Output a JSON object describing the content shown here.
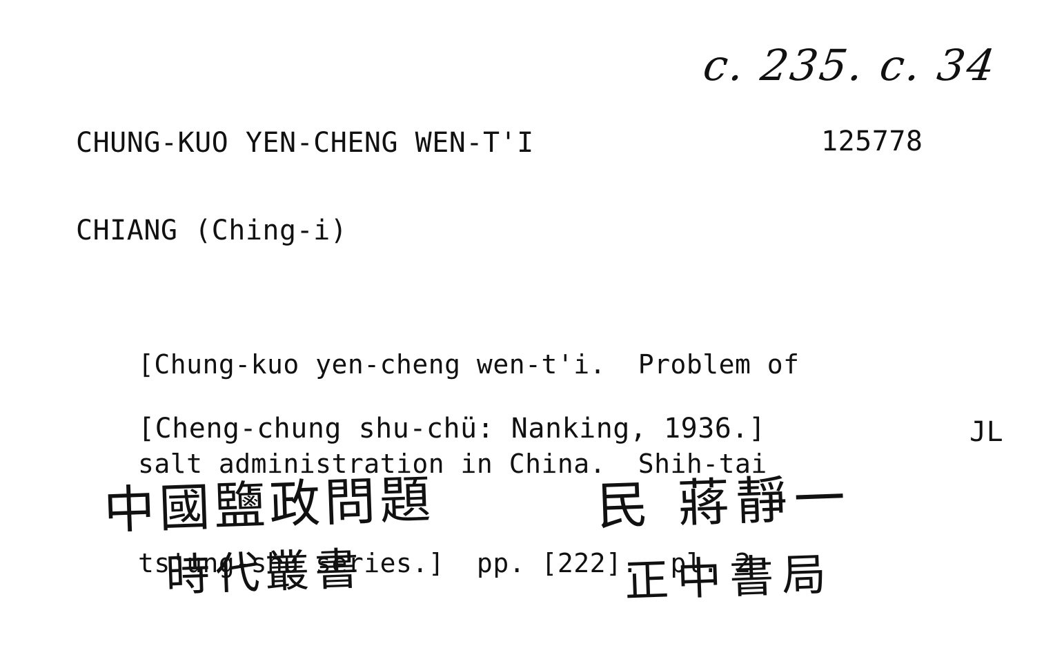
{
  "card": {
    "shelfmark": "c. 235. c. 34",
    "heading": "CHUNG-KUO YEN-CHENG WEN-T'I",
    "number": "125778",
    "author": "CHIANG (Ching-i)",
    "description_lines": [
      "[Chung-kuo yen-cheng wen-t'i.  Problem of",
      "salt administration in China.  Shih-tai",
      "ts'ung-shu series.]  pp. [222].  pl. 2"
    ],
    "imprint": "[Cheng-chung shu-chü: Nanking, 1936.]",
    "initials": "JL",
    "handwritten": {
      "title_chinese": "中國鹽政問題",
      "series_chinese": "時代叢書",
      "author_chinese": "民 蔣靜一",
      "publisher_chinese": "正中書局"
    }
  }
}
